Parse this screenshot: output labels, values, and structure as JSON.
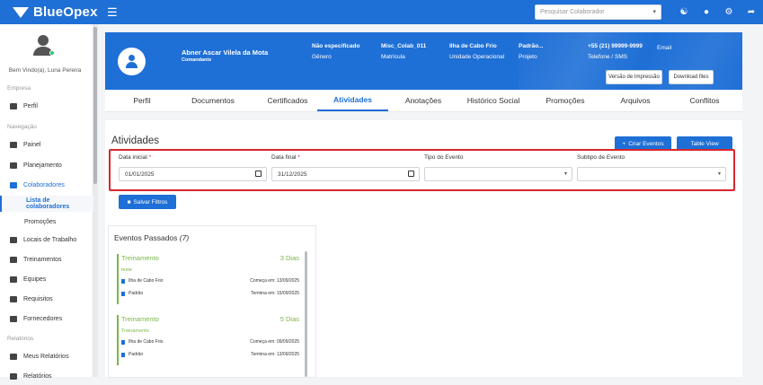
{
  "app": {
    "name": "BlueOpex",
    "search_placeholder": "Pesquisar Colaborador"
  },
  "topbar_icons": [
    "headset-icon",
    "bell-icon",
    "gear-icon",
    "logout-icon"
  ],
  "sidebar": {
    "welcome": "Bem Vindo(a), Luna Pereira",
    "sections": {
      "empresa": "Empresa",
      "navegacao": "Navegação",
      "relatorios": "Relatórios"
    },
    "items": {
      "perfil": "Perfil",
      "painel": "Painel",
      "planejamento": "Planejamento",
      "colaboradores": "Colaboradores",
      "lista": "Lista de colaboradores",
      "promocoes": "Promoções",
      "locais": "Locais de Trabalho",
      "treinamentos": "Treinamentos",
      "equipes": "Equipes",
      "requisitos": "Requisitos",
      "fornecedores": "Fornecedores",
      "meus_relatorios": "Meus Relatórios",
      "relatorios_cut": "Relatórios"
    }
  },
  "profile": {
    "name": "Abner Ascar Vilela da Mota",
    "role": "Comandante",
    "genero_val": "Não especificado",
    "genero_label": "Gênero",
    "matricula_val": "Misc_Colab_011",
    "matricula_label": "Matrícula",
    "unidade_val": "Ilha de Cabo Frio",
    "unidade_label": "Unidade Operacional",
    "projeto_val": "Padrão...",
    "projeto_label": "Projeto",
    "phone_val": "+55 (21) 99999-9999",
    "phone_label": "Telefone / SMS",
    "email_label": "Email",
    "print_btn": "Versão de Impressão",
    "download_btn": "Download files"
  },
  "tabs": [
    "Perfil",
    "Documentos",
    "Certificados",
    "Atividades",
    "Anotações",
    "Histórico Social",
    "Promoções",
    "Arquivos",
    "Conflitos"
  ],
  "active_tab": "Atividades",
  "activities": {
    "title": "Atividades",
    "create_btn": "Criar Eventos",
    "table_view_btn": "Table View",
    "data_inicial_label": "Data inicial",
    "data_inicial_val": "01/01/2025",
    "data_final_label": "Data final",
    "data_final_val": "31/12/2025",
    "tipo_label": "Tipo do Evento",
    "subtipo_label": "Subtipo de Evento",
    "save_filters_btn": "Salvar Filtros"
  },
  "events": {
    "title": "Eventos Passados",
    "count": "(7)",
    "items": [
      {
        "name": "Treinamento",
        "days": "3 Dias",
        "sub": "teste",
        "location": "Ilha de Cabo Frio",
        "project": "Padrão",
        "start": "Começa em: 13/09/2025",
        "end": "Termina em: 15/09/2025"
      },
      {
        "name": "Treinamento",
        "days": "5 Dias",
        "sub": "Treinamento",
        "location": "Ilha de Cabo Frio",
        "project": "Padrão",
        "start": "Começa em: 09/09/2025",
        "end": "Termina em: 13/09/2025"
      }
    ]
  },
  "colors": {
    "primary": "#1e6fd6",
    "highlight": "#d9262e",
    "event": "#7ab648"
  }
}
